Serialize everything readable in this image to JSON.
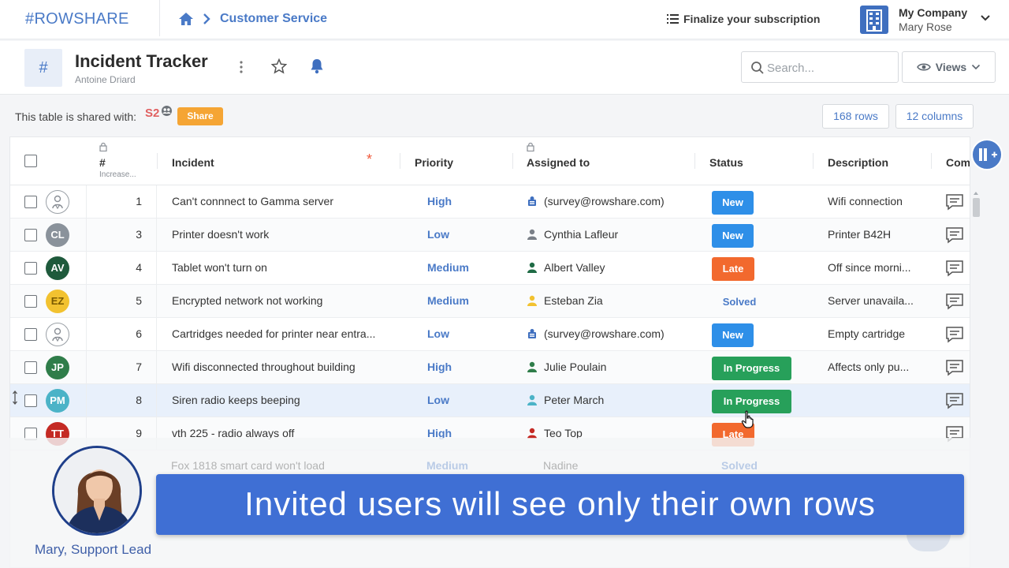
{
  "app": {
    "logo_hash": "#",
    "logo_name": "ROWSHARE"
  },
  "breadcrumb": {
    "current": "Customer Service"
  },
  "header": {
    "subscription_link": "Finalize your subscription",
    "company_name": "My Company",
    "company_user": "Mary Rose"
  },
  "table": {
    "icon_glyph": "#",
    "title": "Incident Tracker",
    "owner": "Antoine Driard",
    "search_placeholder": "Search...",
    "views_label": "Views"
  },
  "share": {
    "label": "This table is shared with:",
    "avatar_text": "S2",
    "button": "Share",
    "rows_count": "168 rows",
    "columns_count": "12 columns"
  },
  "columns": {
    "number": "#",
    "number_sub": "Increase...",
    "incident": "Incident",
    "priority": "Priority",
    "assigned": "Assigned to",
    "status": "Status",
    "description": "Description",
    "comments": "Comm"
  },
  "rows": [
    {
      "avatar": "",
      "num": "1",
      "incident": "Can't connnect to Gamma server",
      "priority": "High",
      "assignee": "(survey@rowshare.com)",
      "status": "New",
      "description": "Wifi connection"
    },
    {
      "avatar": "CL",
      "num": "3",
      "incident": "Printer doesn't work",
      "priority": "Low",
      "assignee": "Cynthia Lafleur",
      "status": "New",
      "description": "Printer B42H"
    },
    {
      "avatar": "AV",
      "num": "4",
      "incident": "Tablet won't turn on",
      "priority": "Medium",
      "assignee": "Albert Valley",
      "status": "Late",
      "description": "Off since morni..."
    },
    {
      "avatar": "EZ",
      "num": "5",
      "incident": "Encrypted network not working",
      "priority": "Medium",
      "assignee": "Esteban Zia",
      "status": "Solved",
      "description": "Server unavaila..."
    },
    {
      "avatar": "",
      "num": "6",
      "incident": "Cartridges needed for printer near entra...",
      "priority": "Low",
      "assignee": "(survey@rowshare.com)",
      "status": "New",
      "description": "Empty cartridge"
    },
    {
      "avatar": "JP",
      "num": "7",
      "incident": "Wifi disconnected throughout building",
      "priority": "High",
      "assignee": "Julie Poulain",
      "status": "In Progress",
      "description": "Affects only pu..."
    },
    {
      "avatar": "PM",
      "num": "8",
      "incident": "Siren radio keeps beeping",
      "priority": "Low",
      "assignee": "Peter March",
      "status": "In Progress",
      "description": ""
    },
    {
      "avatar": "TT",
      "num": "9",
      "incident": "vth 225 - radio always off",
      "priority": "High",
      "assignee": "Teo Top",
      "status": "Late",
      "description": ""
    }
  ],
  "ghost_row": {
    "incident": "Fox 1818 smart card won't load",
    "priority": "Medium",
    "assignee": "Nadine",
    "status": "Solved"
  },
  "colors": {
    "brand": "#4a7ac7",
    "new": "#2e8fe8",
    "late": "#f2692e",
    "in_progress": "#27a05a",
    "solved": "#4a7ac7",
    "share": "#f5a534",
    "banner": "#3f6fd4"
  },
  "overlay": {
    "banner_text": "Invited users will see only their own rows",
    "presenter_caption": "Mary, Support Lead"
  }
}
